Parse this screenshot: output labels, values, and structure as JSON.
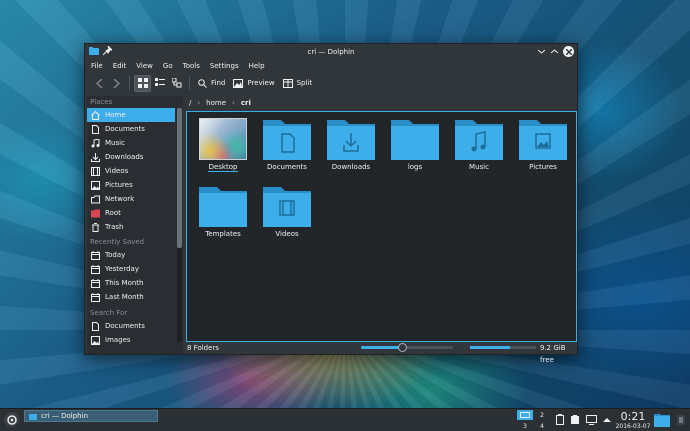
{
  "window": {
    "title": "cri — Dolphin",
    "menu": [
      "File",
      "Edit",
      "View",
      "Go",
      "Tools",
      "Settings",
      "Help"
    ],
    "toolbar": {
      "find": "Find",
      "preview": "Preview",
      "split": "Split"
    }
  },
  "sidebar": {
    "places_header": "Places",
    "places": [
      {
        "label": "Home",
        "icon": "home-icon",
        "selected": true
      },
      {
        "label": "Documents",
        "icon": "documents-icon"
      },
      {
        "label": "Music",
        "icon": "music-icon"
      },
      {
        "label": "Downloads",
        "icon": "downloads-icon"
      },
      {
        "label": "Videos",
        "icon": "videos-icon"
      },
      {
        "label": "Pictures",
        "icon": "pictures-icon"
      },
      {
        "label": "Network",
        "icon": "network-icon"
      },
      {
        "label": "Root",
        "icon": "root-folder-icon"
      },
      {
        "label": "Trash",
        "icon": "trash-icon"
      }
    ],
    "recent_header": "Recently Saved",
    "recent": [
      {
        "label": "Today"
      },
      {
        "label": "Yesterday"
      },
      {
        "label": "This Month"
      },
      {
        "label": "Last Month"
      }
    ],
    "search_header": "Search For",
    "search": [
      {
        "label": "Documents"
      },
      {
        "label": "Images"
      }
    ]
  },
  "breadcrumb": {
    "root": "/",
    "home": "home",
    "current": "cri"
  },
  "files": [
    {
      "label": "Desktop",
      "type": "thumbnail"
    },
    {
      "label": "Documents",
      "type": "folder",
      "emblem": "document-icon"
    },
    {
      "label": "Downloads",
      "type": "folder",
      "emblem": "download-icon"
    },
    {
      "label": "logs",
      "type": "folder",
      "emblem": ""
    },
    {
      "label": "Music",
      "type": "folder",
      "emblem": "music-note-icon"
    },
    {
      "label": "Pictures",
      "type": "folder",
      "emblem": "picture-icon"
    },
    {
      "label": "Templates",
      "type": "folder",
      "emblem": ""
    },
    {
      "label": "Videos",
      "type": "folder",
      "emblem": "film-icon"
    }
  ],
  "status": {
    "count": "8 Folders",
    "zoom_fraction": 0.45,
    "space_used_fraction": 0.6,
    "free": "9.2 GiB free"
  },
  "panel": {
    "task_title": "cri — Dolphin",
    "pager": [
      "1",
      "2",
      "3",
      "4"
    ],
    "active_desktop": "1",
    "time": "0:21",
    "date": "2016-03-07"
  },
  "colors": {
    "accent": "#3daee9",
    "window_bg": "#31363b",
    "view_bg": "#232629"
  }
}
